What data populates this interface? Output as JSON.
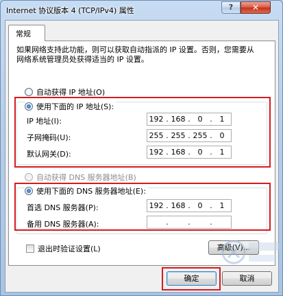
{
  "window": {
    "title": "Internet 协议版本 4 (TCP/IPv4) 属性",
    "help_glyph": "?",
    "close_glyph": "✕"
  },
  "tab": {
    "label": "常规"
  },
  "description": "如果网络支持此功能，则可以获取自动指派的 IP 设置。否则，您需要从网络系统管理员处获得适当的 IP 设置。",
  "ip_section": {
    "auto_label": "自动获得 IP 地址(O)",
    "manual_label": "使用下面的 IP 地址(S):",
    "selected": "manual",
    "fields": [
      {
        "label": "IP 地址(I):",
        "octets": [
          "192",
          "168",
          "0",
          "1"
        ]
      },
      {
        "label": "子网掩码(U):",
        "octets": [
          "255",
          "255",
          "255",
          "0"
        ]
      },
      {
        "label": "默认网关(D):",
        "octets": [
          "192",
          "168",
          "0",
          "1"
        ]
      }
    ]
  },
  "dns_section": {
    "auto_label": "自动获得 DNS 服务器地址(B)",
    "manual_label": "使用下面的 DNS 服务器地址(E):",
    "selected": "manual",
    "fields": [
      {
        "label": "首选 DNS 服务器(P):",
        "octets": [
          "192",
          "168",
          "0",
          "1"
        ]
      },
      {
        "label": "备用 DNS 服务器(A):",
        "octets": [
          "",
          "",
          "",
          ""
        ]
      }
    ]
  },
  "validate_checkbox": {
    "label": "退出时验证设置(L)",
    "checked": false
  },
  "buttons": {
    "advanced": "高级(V)...",
    "ok": "确定",
    "cancel": "取消"
  },
  "colors": {
    "highlight_box": "#d71920",
    "selected_radio": "#0b3f8a"
  }
}
